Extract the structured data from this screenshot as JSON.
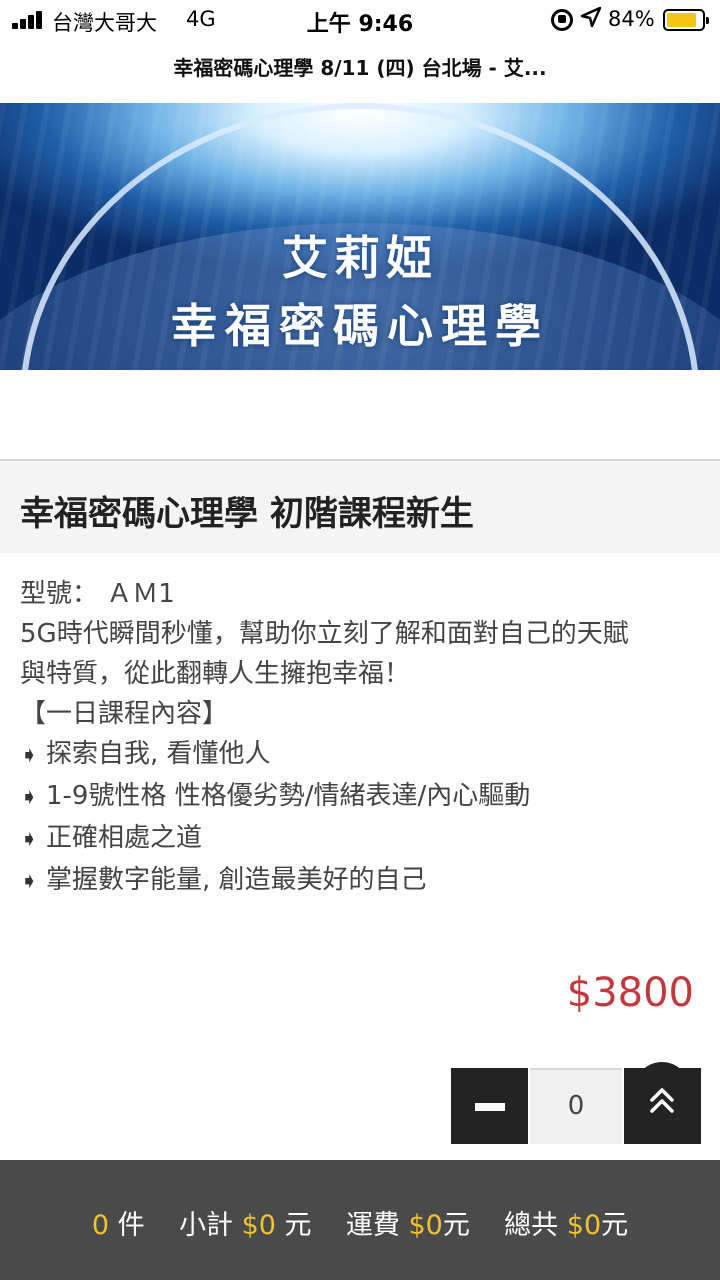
{
  "status_bar": {
    "carrier": "台灣大哥大",
    "network": "4G",
    "time": "上午 9:46",
    "battery_percent": "84%",
    "battery_level": 0.84,
    "icons": [
      "signal-icon",
      "rotation-lock-icon",
      "location-icon",
      "battery-icon"
    ]
  },
  "page": {
    "title": "幸福密碼心理學 8/11 (四) 台北場 - 艾..."
  },
  "banner": {
    "line1": "艾莉婭",
    "line2": "幸福密碼心理學"
  },
  "product": {
    "title": "幸福密碼心理學 初階課程新生",
    "model_label": "型號：",
    "model_value": "ＡＭ1",
    "description_line1": "5G時代瞬間秒懂，幫助你立刻了解和面對自己的天賦",
    "description_line2": "與特質，從此翻轉人生擁抱幸福！",
    "course_heading": "【一日課程內容】",
    "bullets": [
      "探索自我, 看懂他人",
      "1-9號性格 性格優劣勢/情緒表達/內心驅動",
      "正確相處之道",
      "掌握數字能量, 創造最美好的自己"
    ],
    "price": "$3800",
    "quantity": "0"
  },
  "cart": {
    "count": "0",
    "count_unit": "件",
    "subtotal_label": "小計",
    "subtotal": "$0",
    "subtotal_unit": "元",
    "shipping_label": "運費",
    "shipping": "$0",
    "shipping_unit": "元",
    "total_label": "總共",
    "total": "$0",
    "total_unit": "元"
  },
  "colors": {
    "price": "#c0393b",
    "cart_bar": "#4a4a4a",
    "cart_highlight": "#f2c230",
    "control_dark": "#232323"
  }
}
